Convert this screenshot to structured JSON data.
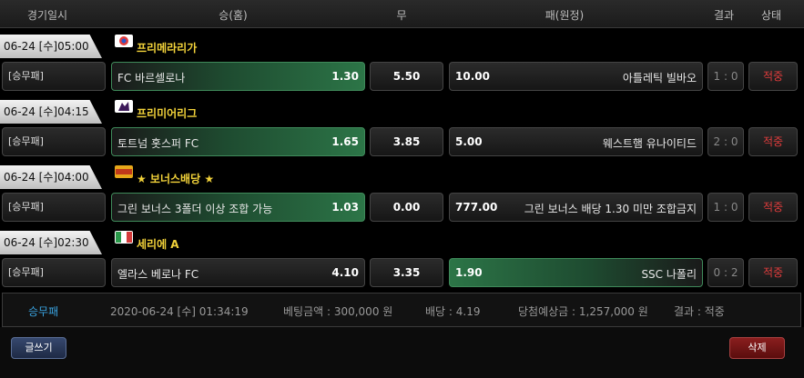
{
  "header": {
    "date": "경기일시",
    "home": "승(홈)",
    "draw": "무",
    "away": "패(원정)",
    "result": "결과",
    "status": "상태"
  },
  "leagues": [
    {
      "time": "06-24 [수]05:00",
      "name": "프리메라리가",
      "flag_icon": "laliga-icon"
    },
    {
      "time": "06-24 [수]04:15",
      "name": "프리미어리그",
      "flag_icon": "premier-league-icon"
    },
    {
      "time": "06-24 [수]04:00",
      "name": "★ 보너스배당 ★",
      "flag_icon": "bonus-icon"
    },
    {
      "time": "06-24 [수]02:30",
      "name": "세리에 A",
      "flag_icon": "serie-a-icon"
    }
  ],
  "bets": [
    {
      "type": "[승무패]",
      "home": "FC 바르셀로나",
      "home_odds": "1.30",
      "draw": "5.50",
      "away_odds": "10.00",
      "away": "아틀레틱 빌바오",
      "score": "1 : 0",
      "status": "적중",
      "selected": "home"
    },
    {
      "type": "[승무패]",
      "home": "토트넘 홋스퍼 FC",
      "home_odds": "1.65",
      "draw": "3.85",
      "away_odds": "5.00",
      "away": "웨스트햄 유나이티드",
      "score": "2 : 0",
      "status": "적중",
      "selected": "home"
    },
    {
      "type": "[승무패]",
      "home": "그린 보너스 3폴더 이상 조합 가능",
      "home_odds": "1.03",
      "draw": "0.00",
      "away_odds": "777.00",
      "away": "그린 보너스 배당 1.30 미만 조합금지",
      "score": "1 : 0",
      "status": "적중",
      "selected": "home"
    },
    {
      "type": "[승무패]",
      "home": "엘라스 베로나 FC",
      "home_odds": "4.10",
      "draw": "3.35",
      "away_odds": "1.90",
      "away": "SSC 나폴리",
      "score": "0 : 2",
      "status": "적중",
      "selected": "away"
    }
  ],
  "summary": {
    "type": "승무패",
    "datetime": "2020-06-24 [수] 01:34:19",
    "bet_amount": "베팅금액 : 300,000 원",
    "odds": "배당 : 4.19",
    "expected": "당첨예상금 : 1,257,000 원",
    "result": "결과 : 적중"
  },
  "buttons": {
    "write": "글쓰기",
    "delete": "삭제"
  },
  "colors": {
    "selected_green": "#2c7547",
    "status_red": "#e03c3c",
    "league_yellow": "#f2d23a",
    "summary_blue": "#3aa3e0"
  }
}
